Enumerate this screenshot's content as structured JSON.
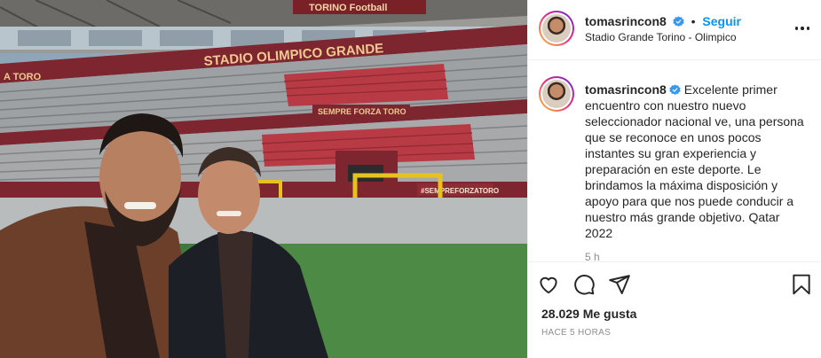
{
  "photo": {
    "stadium_banner_top": "TORINO Football",
    "stadium_name_sign": "STADIO OLIMPICO   GRANDE",
    "left_sign": "A TORO",
    "lower_banner": "SEMPRE FORZA TORO",
    "ad_board": "#SEMPREFORZATORO"
  },
  "header": {
    "username": "tomasrincon8",
    "separator": "•",
    "follow_label": "Seguir",
    "location": "Stadio Grande Torino - Olimpico"
  },
  "caption": {
    "username": "tomasrincon8",
    "text": "Excelente primer encuentro con nuestro nuevo seleccionador nacional ve, una persona que se reconoce en unos pocos instantes su gran experiencia y preparación en este deporte. Le brindamos la máxima disposición y apoyo para que nos puede conducir a nuestro más grande objetivo. Qatar 2022",
    "time_short": "5 h"
  },
  "actions": {
    "likes": "28.029 Me gusta",
    "posted_ago": "HACE 5 HORAS"
  },
  "icons": {
    "verified": "verified-badge-icon",
    "more": "more-options-icon",
    "like": "heart-icon",
    "comment": "comment-icon",
    "share": "send-icon",
    "save": "bookmark-icon"
  },
  "colors": {
    "accent": "#0095f6",
    "verified": "#3897f0",
    "muted": "#8e8e8e",
    "text": "#262626"
  }
}
